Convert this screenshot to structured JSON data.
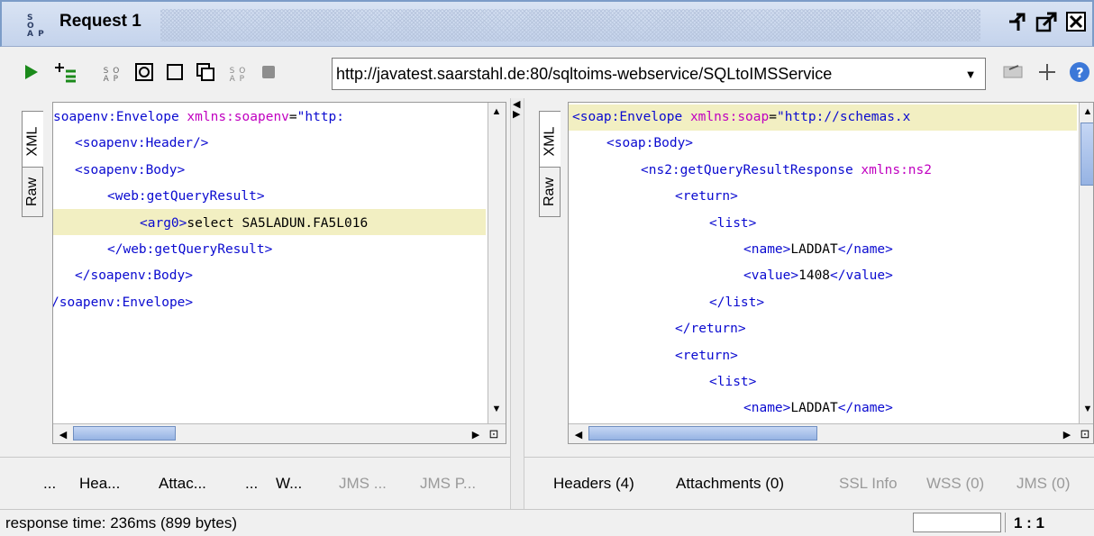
{
  "title_bar": {
    "title": "Request 1",
    "soap_logo": "SO AP"
  },
  "toolbar": {
    "url": "http://javatest.saarstahl.de:80/sqltoims-webservice/SQLtoIMSService",
    "icons": [
      "run-icon",
      "add-step-icon",
      "soap-icon",
      "toggle-icon",
      "stop-square-icon",
      "clone-icon",
      "soap-icon",
      "stop-icon",
      "dropdown-icon",
      "edit-endpoint-icon",
      "plus-icon",
      "help-icon"
    ]
  },
  "request": {
    "side_tabs": {
      "xml": "XML",
      "raw": "Raw"
    },
    "lines": [
      [
        {
          "c": "t",
          "v": "soapenv:Envelope"
        },
        {
          "c": "an",
          "v": " xmlns:soapenv"
        },
        {
          "c": "tx",
          "v": "="
        },
        {
          "c": "av",
          "v": "\"http:"
        }
      ],
      [
        {
          "c": "t",
          "v": "<soapenv:Header/>"
        }
      ],
      [
        {
          "c": "t",
          "v": "<soapenv:Body>"
        }
      ],
      [
        {
          "c": "t",
          "v": "<web:getQueryResult>"
        }
      ],
      [
        {
          "c": "t",
          "v": "<arg0>"
        },
        {
          "c": "tx",
          "v": "select SA5LADUN.FA5L016"
        }
      ],
      [
        {
          "c": "t",
          "v": "</web:getQueryResult>"
        }
      ],
      [
        {
          "c": "t",
          "v": "</soapenv:Body>"
        }
      ],
      [
        {
          "c": "t",
          "v": "/soapenv:Envelope>"
        }
      ]
    ],
    "bottom_tabs": [
      "...",
      "Hea...",
      "Attac...",
      "...",
      "W...",
      "JMS ...",
      "JMS P..."
    ]
  },
  "response": {
    "side_tabs": {
      "xml": "XML",
      "raw": "Raw"
    },
    "lines": [
      [
        {
          "c": "t",
          "v": "<soap:Envelope"
        },
        {
          "c": "an",
          "v": " xmlns:soap"
        },
        {
          "c": "tx",
          "v": "="
        },
        {
          "c": "av",
          "v": "\"http://schemas.x"
        }
      ],
      [
        {
          "c": "t",
          "v": "<soap:Body>"
        }
      ],
      [
        {
          "c": "t",
          "v": "<ns2:getQueryResultResponse"
        },
        {
          "c": "an",
          "v": " xmlns:ns2"
        }
      ],
      [
        {
          "c": "t",
          "v": "<return>"
        }
      ],
      [
        {
          "c": "t",
          "v": "<list>"
        }
      ],
      [
        {
          "c": "t",
          "v": "<name>"
        },
        {
          "c": "tx",
          "v": "LADDAT"
        },
        {
          "c": "t",
          "v": "</name>"
        }
      ],
      [
        {
          "c": "t",
          "v": "<value>"
        },
        {
          "c": "tx",
          "v": "1408"
        },
        {
          "c": "t",
          "v": "</value>"
        }
      ],
      [
        {
          "c": "t",
          "v": "</list>"
        }
      ],
      [
        {
          "c": "t",
          "v": "</return>"
        }
      ],
      [
        {
          "c": "t",
          "v": "<return>"
        }
      ],
      [
        {
          "c": "t",
          "v": "<list>"
        }
      ],
      [
        {
          "c": "t",
          "v": "<name>"
        },
        {
          "c": "tx",
          "v": "LADDAT"
        },
        {
          "c": "t",
          "v": "</name>"
        }
      ]
    ],
    "bottom_tabs": [
      "Headers (4)",
      "Attachments (0)",
      "SSL Info",
      "WSS (0)",
      "JMS (0)"
    ]
  },
  "status": {
    "text": "response time: 236ms (899 bytes)",
    "ratio": "1 : 1"
  },
  "colors": {
    "tag": "#0a0ad0",
    "attr_name": "#c000c0",
    "highlight": "#f2efc2",
    "title_bg": "#c8d6ee"
  }
}
